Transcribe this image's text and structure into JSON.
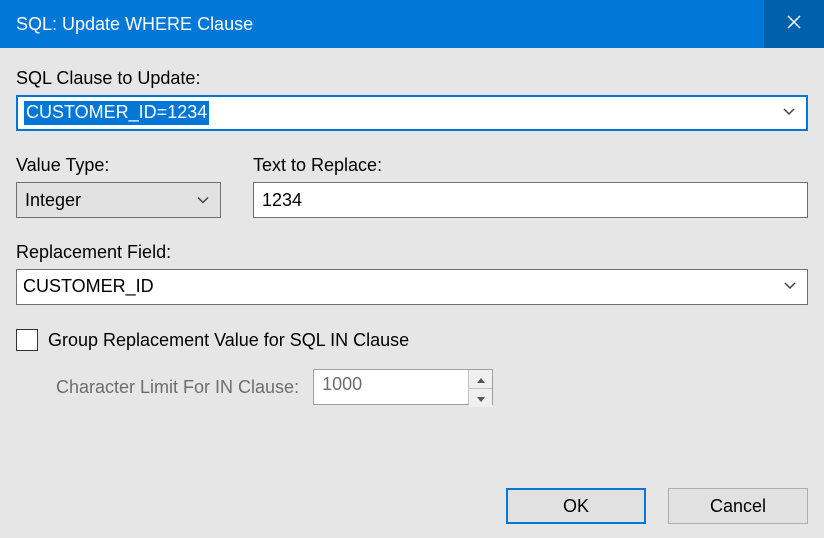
{
  "title": "SQL: Update WHERE Clause",
  "labels": {
    "clause": "SQL Clause to Update:",
    "valueType": "Value Type:",
    "textToReplace": "Text to Replace:",
    "replacementField": "Replacement Field:",
    "groupCheck": "Group Replacement Value for SQL IN Clause",
    "charLimit": "Character Limit For IN Clause:"
  },
  "fields": {
    "clause": "CUSTOMER_ID=1234",
    "valueType": "Integer",
    "textToReplace": "1234",
    "replacementField": "CUSTOMER_ID",
    "charLimit": "1000"
  },
  "buttons": {
    "ok": "OK",
    "cancel": "Cancel"
  }
}
